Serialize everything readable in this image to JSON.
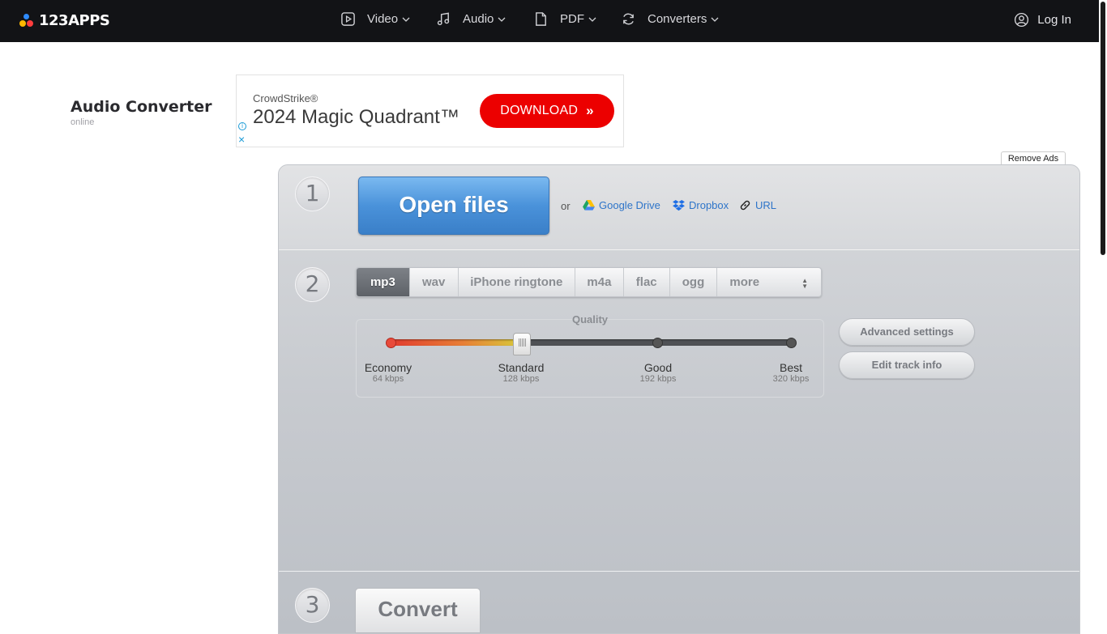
{
  "header": {
    "logo_text": "123APPS",
    "nav": [
      {
        "label": "Video",
        "icon": "video-play-icon"
      },
      {
        "label": "Audio",
        "icon": "music-note-icon"
      },
      {
        "label": "PDF",
        "icon": "document-icon"
      },
      {
        "label": "Converters",
        "icon": "refresh-icon"
      }
    ],
    "login_label": "Log In"
  },
  "page": {
    "title": "Audio Converter",
    "subtitle": "online"
  },
  "ad": {
    "brand": "CrowdStrike®",
    "headline": "2024 Magic Quadrant™",
    "button_label": "DOWNLOAD",
    "button_color": "#ec0000"
  },
  "remove_ads_label": "Remove Ads",
  "steps": {
    "step1": {
      "number": "1",
      "open_label": "Open files",
      "or_label": "or",
      "sources": [
        "Google Drive",
        "Dropbox",
        "URL"
      ]
    },
    "step2": {
      "number": "2",
      "formats": [
        "mp3",
        "wav",
        "iPhone ringtone",
        "m4a",
        "flac",
        "ogg",
        "more"
      ],
      "selected_format": "mp3",
      "quality": {
        "label": "Quality",
        "selected": "Standard",
        "levels": [
          {
            "name": "Economy",
            "kbps": "64 kbps"
          },
          {
            "name": "Standard",
            "kbps": "128 kbps"
          },
          {
            "name": "Good",
            "kbps": "192 kbps"
          },
          {
            "name": "Best",
            "kbps": "320 kbps"
          }
        ]
      },
      "advanced_label": "Advanced settings",
      "edit_track_label": "Edit track info"
    },
    "step3": {
      "number": "3",
      "convert_label": "Convert"
    }
  },
  "colors": {
    "topbar": "#121316",
    "link": "#2e74c9",
    "open_button": "#4a92da"
  }
}
